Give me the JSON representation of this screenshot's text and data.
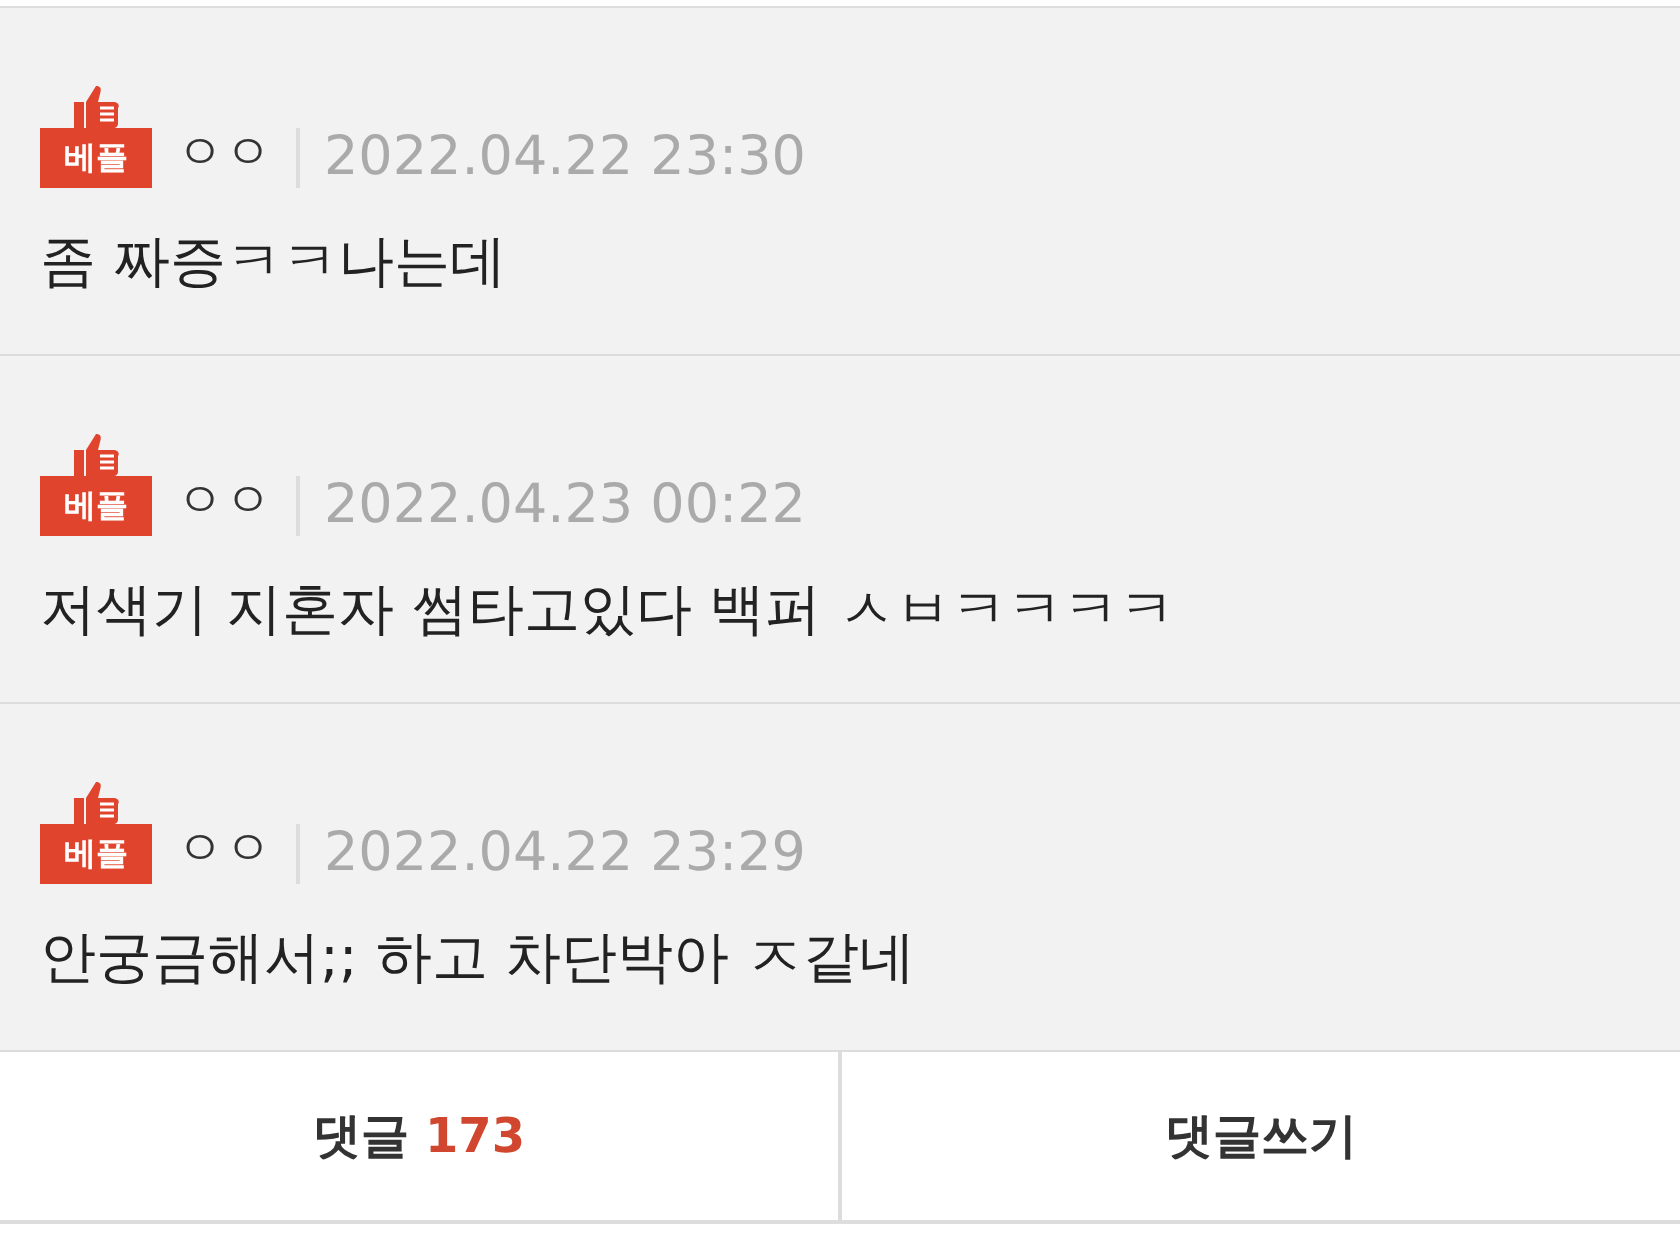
{
  "comments": [
    {
      "badge": "베플",
      "author": "ㅇㅇ",
      "date": "2022.04.22 23:30",
      "text": "좀 짜증ㅋㅋ나는데"
    },
    {
      "badge": "베플",
      "author": "ㅇㅇ",
      "date": "2022.04.23 00:22",
      "text": "저색기 지혼자 썸타고있다 백퍼 ㅅㅂㅋㅋㅋㅋ"
    },
    {
      "badge": "베플",
      "author": "ㅇㅇ",
      "date": "2022.04.22 23:29",
      "text": "안궁금해서;; 하고 차단박아 ㅈ같네"
    }
  ],
  "footer": {
    "comments_label": "댓글",
    "comments_count": "173",
    "write_label": "댓글쓰기"
  }
}
